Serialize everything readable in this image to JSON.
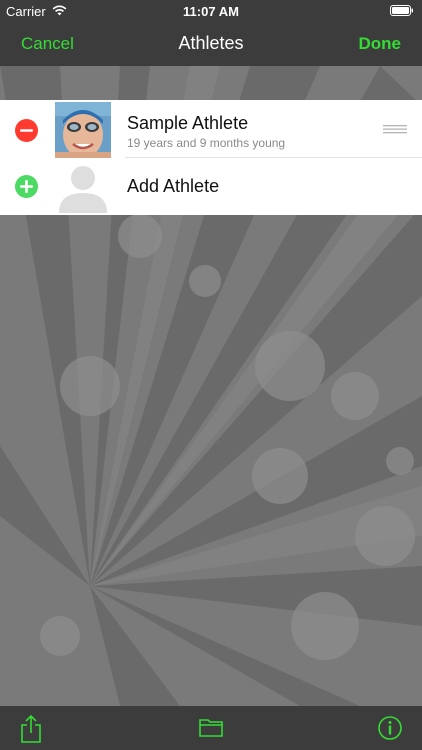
{
  "status_bar": {
    "carrier": "Carrier",
    "time": "11:07 AM",
    "icons": [
      "wifi-icon",
      "battery-icon"
    ]
  },
  "nav": {
    "cancel_label": "Cancel",
    "title": "Athletes",
    "done_label": "Done"
  },
  "athletes": [
    {
      "name": "Sample Athlete",
      "age_text": "19 years and 9 months young",
      "edit_control": "delete-control",
      "accessory": "reorder-icon"
    }
  ],
  "add_row": {
    "label": "Add Athlete",
    "edit_control": "insert-control",
    "icon": "person-placeholder-icon"
  },
  "toolbar": {
    "icons": [
      "share-icon",
      "folder-icon",
      "info-icon"
    ]
  },
  "colors": {
    "accent": "#33dd33",
    "bar_background": "#3c3c3c",
    "delete_red": "#ff3b30",
    "insert_green": "#4cd964"
  }
}
